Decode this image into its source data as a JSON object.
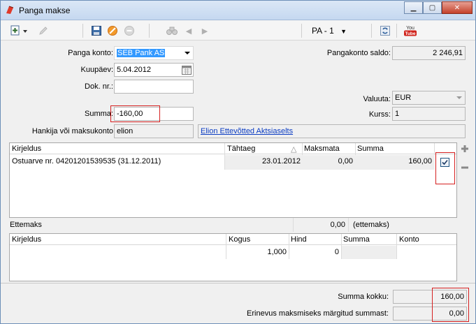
{
  "window": {
    "title": "Panga makse"
  },
  "toolbar": {
    "document_selector": "PA - 1",
    "youtube_label": "You Tube"
  },
  "form": {
    "panga_konto_label": "Panga konto:",
    "panga_konto_value": "SEB Pank AS",
    "kuupaev_label": "Kuupäev:",
    "kuupaev_value": "5.04.2012",
    "dok_nr_label": "Dok. nr.:",
    "dok_nr_value": "",
    "summa_label": "Summa:",
    "summa_value": "-160,00",
    "hankija_label": "Hankija või maksukonto",
    "hankija_value": "elion",
    "hankija_name": "Elion Ettevõtted Aktsiaselts",
    "saldo_label": "Pangakonto saldo:",
    "saldo_value": "2 246,91",
    "valuuta_label": "Valuuta:",
    "valuuta_value": "EUR",
    "kurss_label": "Kurss:",
    "kurss_value": "1"
  },
  "invoices": {
    "columns": [
      "Kirjeldus",
      "Tähtaeg",
      "Maksmata",
      "Summa"
    ],
    "sort_indicator": "△",
    "rows": [
      {
        "kirjeldus": "Ostuarve nr. 04201201539535 (31.12.2011)",
        "tahtaeg": "23.01.2012",
        "maksmata": "0,00",
        "summa": "160,00",
        "checked": true
      }
    ]
  },
  "ettemaks": {
    "label": "Ettemaks",
    "value": "0,00",
    "suffix": "(ettemaks)"
  },
  "prepay_grid": {
    "columns": [
      "Kirjeldus",
      "Kogus",
      "Hind",
      "Summa",
      "Konto"
    ],
    "rows": [
      {
        "kirjeldus": "",
        "kogus": "1,000",
        "hind": "0",
        "summa": "",
        "konto": ""
      }
    ]
  },
  "footer": {
    "summa_kokku_label": "Summa kokku:",
    "summa_kokku_value": "160,00",
    "erinevus_label": "Erinevus maksmiseks märgitud summast:",
    "erinevus_value": "0,00"
  },
  "colors": {
    "highlight_border": "#d52020",
    "selection": "#3399ff",
    "link": "#0b3cc2"
  }
}
